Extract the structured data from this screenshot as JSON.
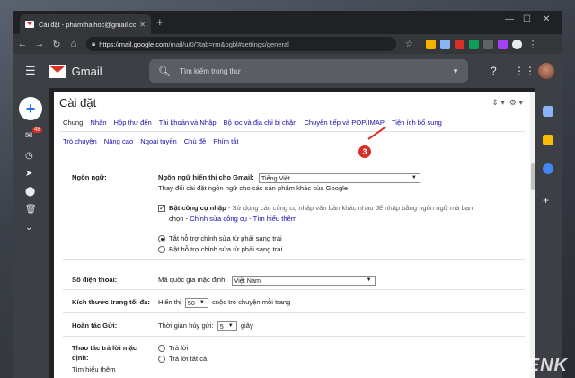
{
  "browser": {
    "tab_title": "Cài đặt - phamthaihoc@gmail.co",
    "url_host": "https://mail.google.com",
    "url_path": "/mail/u/0/?tab=rm&ogbl#settings/general"
  },
  "gmail": {
    "app_name": "Gmail",
    "search_placeholder": "Tìm kiếm trong thư",
    "inbox_badge": "48"
  },
  "settings": {
    "title": "Cài đặt",
    "tabs_row1": [
      "Chung",
      "Nhãn",
      "Hộp thư đến",
      "Tài khoản và Nhập",
      "Bộ lọc và địa chỉ bị chặn",
      "Chuyển tiếp và POP/IMAP",
      "Tiện ích bổ sung"
    ],
    "tabs_row2": [
      "Trò chuyện",
      "Nâng cao",
      "Ngoại tuyến",
      "Chủ đề",
      "Phím tắt"
    ],
    "active_tab": "Chung",
    "step_marker": "3",
    "language": {
      "label": "Ngôn ngữ:",
      "display_label": "Ngôn ngữ hiển thị cho Gmail:",
      "display_value": "Tiếng Việt",
      "change_link": "Thay đổi cài đặt ngôn ngữ cho các sản phẩm khác của Google",
      "input_tools_label": "Bật công cụ nhập",
      "input_tools_desc": " - Sử dụng các công cụ nhập văn bản khác nhau để nhập bằng ngôn ngữ mà bạn",
      "input_tools_desc2": "chọn - ",
      "edit_tools_link": "Chỉnh sửa công cụ",
      "learn_more_link": "Tìm hiểu thêm",
      "rtl_off": "Tắt hỗ trợ chỉnh sửa từ phải sang trái",
      "rtl_on": "Bật hỗ trợ chỉnh sửa từ phải sang trái"
    },
    "phone": {
      "label": "Số điện thoại:",
      "country_label": "Mã quốc gia mặc định:",
      "country_value": "Việt Nam"
    },
    "page_size": {
      "label": "Kích thước trang tối đa:",
      "prefix": "Hiển thị",
      "value": "50",
      "suffix": "cuộc trò chuyện mỗi trang"
    },
    "undo_send": {
      "label": "Hoàn tác Gửi:",
      "prefix": "Thời gian hủy gửi:",
      "value": "5",
      "suffix": "giây"
    },
    "reply": {
      "label1": "Thao tác trả lời mặc",
      "label2": "định:",
      "learn_more": "Tìm hiểu thêm",
      "opt_reply": "Trả lời",
      "opt_reply_all": "Trả lời tất cả"
    }
  },
  "watermark": "GENK",
  "colors": {
    "accent_red": "#d93025",
    "link_blue": "#1a0dab",
    "header_bg": "#3c3f44"
  }
}
